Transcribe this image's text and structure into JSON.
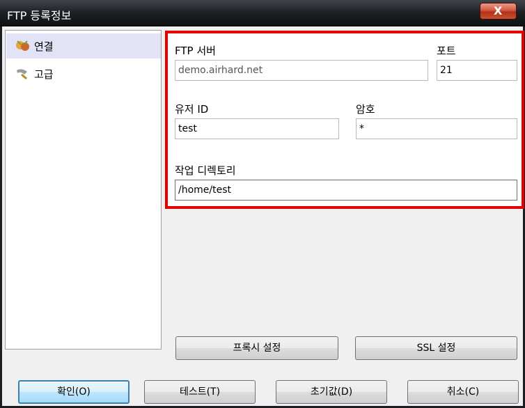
{
  "window": {
    "title": "FTP 등록정보",
    "close_label": "X"
  },
  "sidebar": {
    "items": [
      {
        "label": "연결",
        "icon": "connection-icon",
        "selected": true
      },
      {
        "label": "고급",
        "icon": "advanced-icon",
        "selected": false
      }
    ]
  },
  "form": {
    "server_label": "FTP 서버",
    "server_value": "demo.airhard.net",
    "port_label": "포트",
    "port_value": "21",
    "user_label": "유저 ID",
    "user_value": "test",
    "password_label": "암호",
    "password_value": "*",
    "dir_label": "작업 디렉토리",
    "dir_value": "/home/test"
  },
  "panel_buttons": {
    "proxy": "프록시 설정",
    "ssl": "SSL 설정"
  },
  "footer": {
    "ok": "확인(O)",
    "test": "테스트(T)",
    "reset": "초기값(D)",
    "cancel": "취소(C)"
  },
  "colors": {
    "highlight_border": "#e50000",
    "selected_item": "#e3e3f7"
  }
}
